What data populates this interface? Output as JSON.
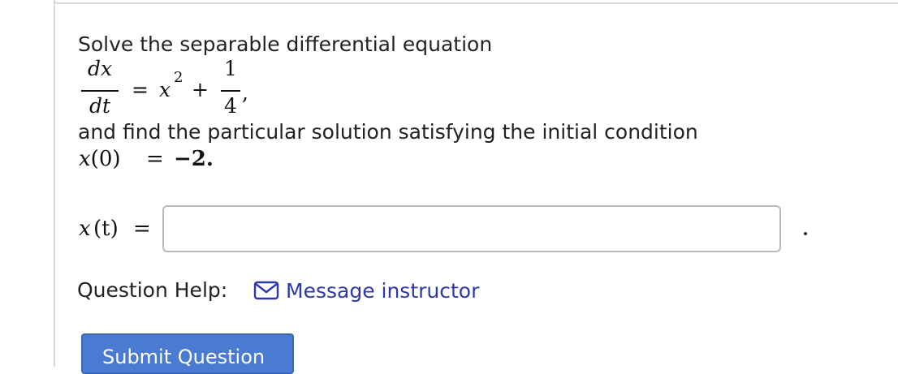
{
  "question": {
    "intro": "Solve the separable differential equation",
    "equation": {
      "lhs_numerator": "dx",
      "lhs_denominator": "dt",
      "equals": "=",
      "x": "x",
      "exponent": "2",
      "plus": "+",
      "rhs_numerator": "1",
      "rhs_denominator": "4",
      "trailing": ","
    },
    "condition_text": "and find the particular solution satisfying the initial condition",
    "initial_condition": {
      "lhs": "x(0)",
      "equals": "=",
      "rhs": "−2."
    }
  },
  "answer": {
    "label_var": "x",
    "label_arg": "(t)",
    "equals": "=",
    "value": "",
    "placeholder": ""
  },
  "help": {
    "label": "Question Help:",
    "message_link": "Message instructor",
    "icon": "mail-icon"
  },
  "submit": {
    "label": "Submit Question"
  },
  "colors": {
    "link": "#2c3aa8",
    "button": "#4b7bd0",
    "border": "#d8d8d8"
  }
}
